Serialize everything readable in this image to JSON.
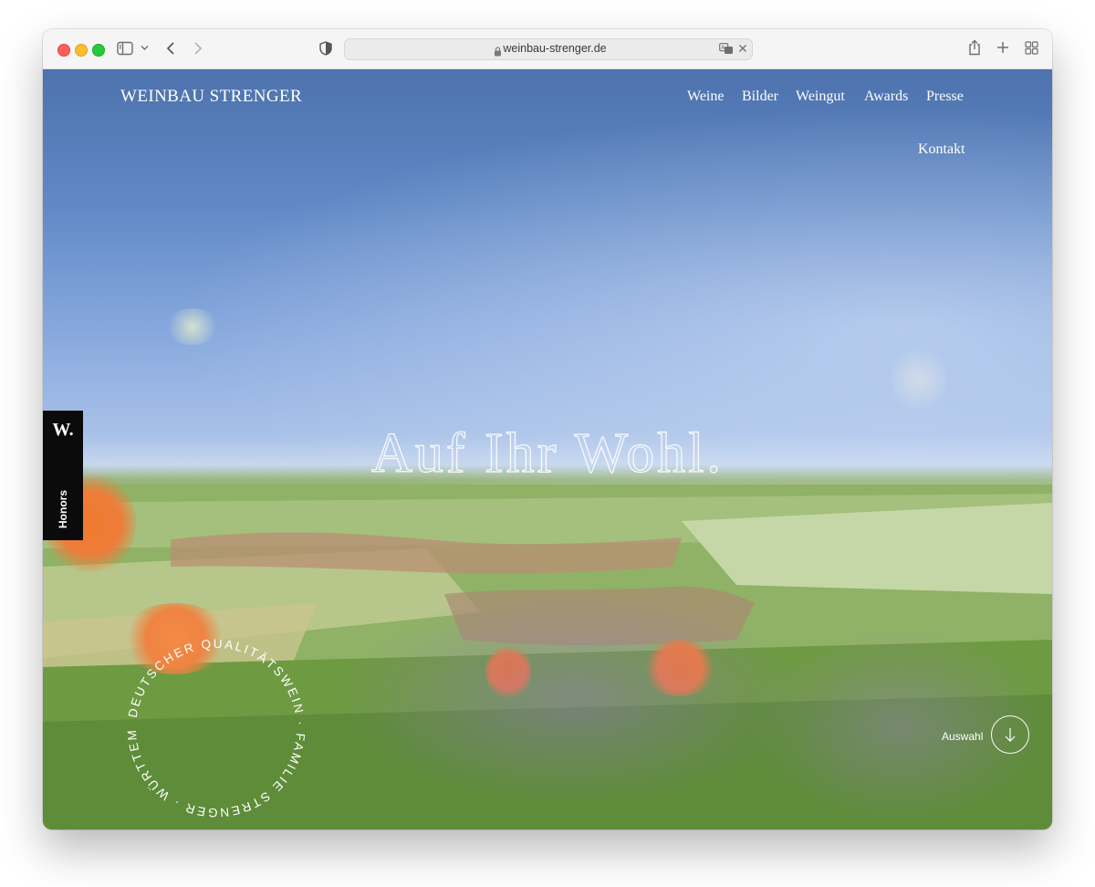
{
  "browser": {
    "url": "weinbau-strenger.de",
    "icons": {
      "sidebar": "sidebar-icon",
      "chevron": "chevron-down-icon",
      "back": "back-arrow-icon",
      "forward": "forward-arrow-icon",
      "shield": "privacy-shield-icon",
      "lock": "lock-icon",
      "translate": "translate-icon",
      "clear": "close-icon",
      "share": "share-icon",
      "new_tab": "plus-icon",
      "tabs": "tab-overview-icon"
    }
  },
  "site": {
    "brand": "WEINBAU STRENGER",
    "nav": [
      "Weine",
      "Bilder",
      "Weingut",
      "Awards",
      "Presse",
      "Kontakt"
    ],
    "hero_title": "Auf Ihr Wohl.",
    "honors_tab": {
      "mark": "W.",
      "label": "Honors"
    },
    "seal_text": "DEUTSCHER QUALITÄTSWEIN · FAMILIE STRENGER · WÜRTTEMBERG ·",
    "scroll": {
      "label": "Auswahl",
      "icon": "arrow-down-icon"
    }
  },
  "colors": {
    "sky_top": "#4d72ad",
    "sky_horizon": "#c7d7ee",
    "meadow": "#7aa34a",
    "poppy": "#f07a2e",
    "honors_tab": "#0b0b0b"
  }
}
